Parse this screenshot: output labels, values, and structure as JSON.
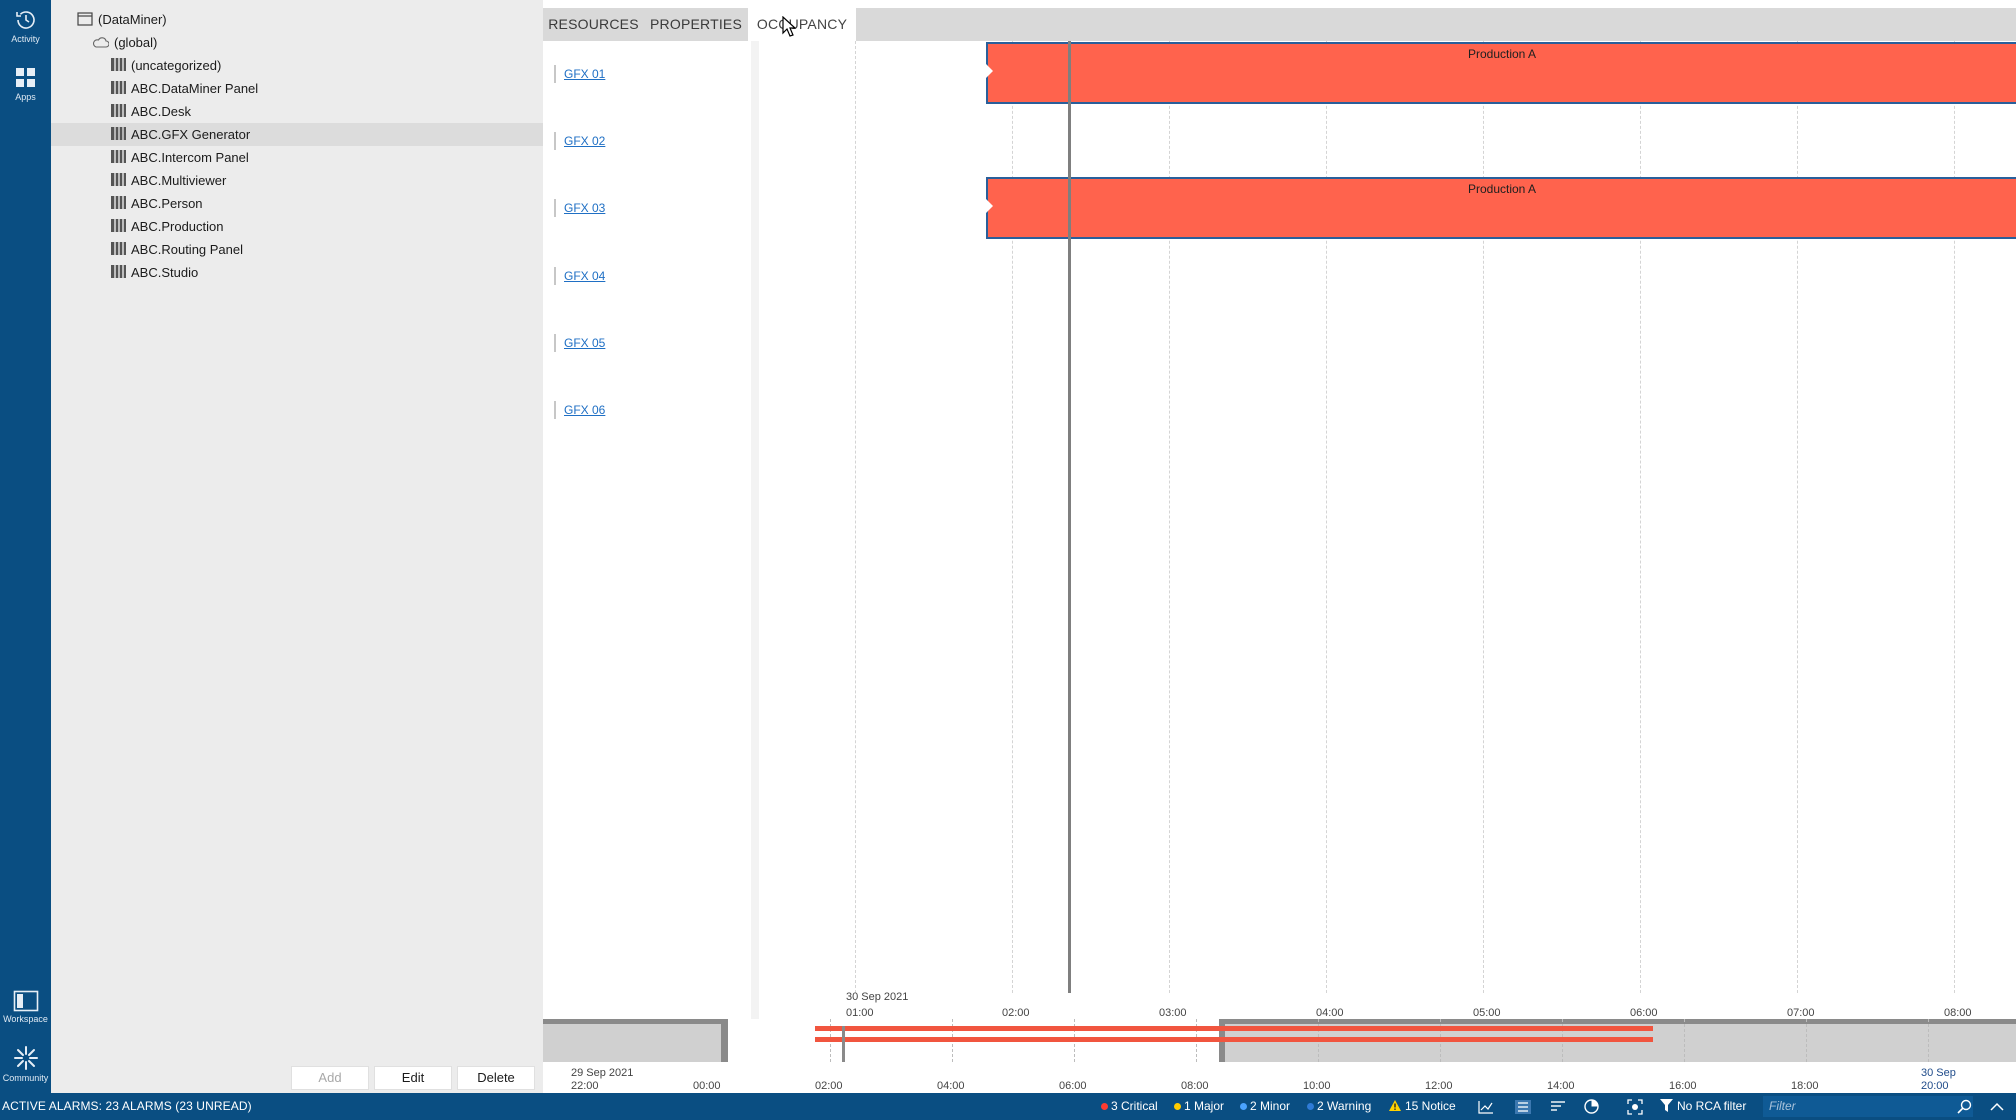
{
  "nav": {
    "activity_label": "Activity",
    "apps_label": "Apps",
    "workspace_label": "Workspace",
    "community_label": "Community"
  },
  "tree": {
    "root": "(DataMiner)",
    "global": "(global)",
    "items": [
      "(uncategorized)",
      "ABC.DataMiner Panel",
      "ABC.Desk",
      "ABC.GFX Generator",
      "ABC.Intercom Panel",
      "ABC.Multiviewer",
      "ABC.Person",
      "ABC.Production",
      "ABC.Routing Panel",
      "ABC.Studio"
    ],
    "selected_item": "ABC.GFX Generator",
    "buttons": {
      "add": "Add",
      "edit": "Edit",
      "delete": "Delete"
    }
  },
  "tabs": [
    {
      "label": "RESOURCES",
      "active": false
    },
    {
      "label": "PROPERTIES",
      "active": false
    },
    {
      "label": "OCCUPANCY",
      "active": true
    }
  ],
  "resources": [
    "GFX 01",
    "GFX 02",
    "GFX 03",
    "GFX 04",
    "GFX 05",
    "GFX 06"
  ],
  "bookings": [
    {
      "resource": "GFX 01",
      "label": "Production A",
      "start": "01:50",
      "color": "#ff634d"
    },
    {
      "resource": "GFX 03",
      "label": "Production A",
      "start": "01:50",
      "color": "#ff634d"
    }
  ],
  "timeline": {
    "date_label": "30 Sep 2021",
    "now_time": "02:22",
    "ticks": [
      "01:00",
      "02:00",
      "03:00",
      "04:00",
      "05:00",
      "06:00",
      "07:00",
      "08:00"
    ]
  },
  "overview": {
    "start_date": "29 Sep 2021",
    "end_date": "30 Sep",
    "ticks": [
      "22:00",
      "00:00",
      "02:00",
      "04:00",
      "06:00",
      "08:00",
      "10:00",
      "12:00",
      "14:00",
      "16:00",
      "18:00",
      "20:00"
    ]
  },
  "status": {
    "active_alarms": "ACTIVE ALARMS: 23 ALARMS (23 UNREAD)",
    "critical": "3 Critical",
    "major": "1 Major",
    "minor": "2 Minor",
    "warning": "2 Warning",
    "notice": "15 Notice",
    "rca": "No RCA filter",
    "filter_placeholder": "Filter",
    "colors": {
      "critical": "#ff3b30",
      "major": "#ffcc00",
      "minor": "#4aa3ff",
      "warning": "#2f7bd6",
      "notice": "#ffd200"
    }
  }
}
